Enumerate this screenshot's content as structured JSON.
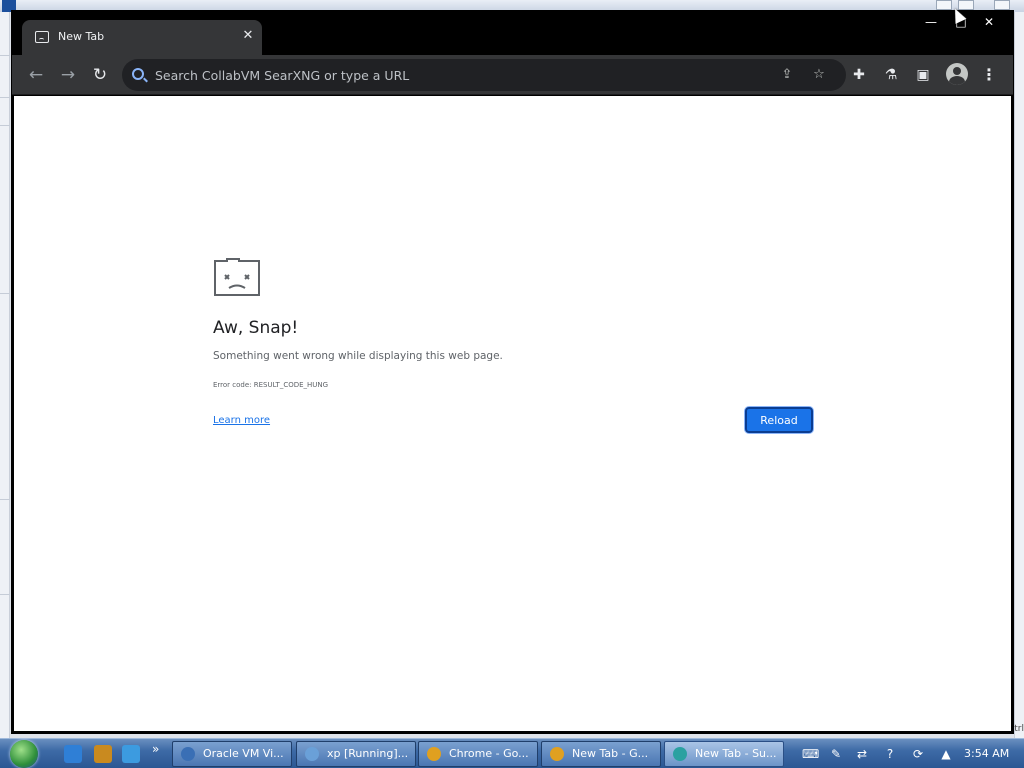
{
  "browser": {
    "tab": {
      "title": "New Tab",
      "close_glyph": "✕",
      "favicon": "sad-tab-icon"
    },
    "window_controls": {
      "minimize": "—",
      "maximize": "□",
      "close": "✕"
    },
    "toolbar": {
      "back_glyph": "←",
      "forward_glyph": "→",
      "reload_glyph": "↻",
      "omnibox_placeholder": "Search CollabVM SearXNG or type a URL",
      "share_glyph": "⇪",
      "bookmark_glyph": "☆",
      "extensions_glyph": "✚",
      "labs_glyph": "⚗",
      "sidepanel_glyph": "▣",
      "menu_glyph": "⋮"
    }
  },
  "error_page": {
    "title": "Aw, Snap!",
    "message": "Something went wrong while displaying this web page.",
    "code": "Error code: RESULT_CODE_HUNG",
    "learn_more": "Learn more",
    "reload_label": "Reload",
    "accent_color": "#1a73e8"
  },
  "host": {
    "ctrl_text": "ctrl"
  },
  "taskbar": {
    "quick_launch_more": "»",
    "buttons": [
      {
        "label": "Oracle VM Vi...",
        "icon": "virtualbox-icon",
        "color": "#3a6fb5"
      },
      {
        "label": "xp [Running]...",
        "icon": "vm-running-icon",
        "color": "#6aa0d8"
      },
      {
        "label": "Chrome - Go...",
        "icon": "chrome-icon",
        "color": "#e0a020"
      },
      {
        "label": "New Tab - G...",
        "icon": "chrome-icon",
        "color": "#e0a020"
      },
      {
        "label": "New Tab - Su...",
        "icon": "app-icon",
        "color": "#2ba1a1"
      }
    ],
    "tray": {
      "keyboard_glyph": "⌨",
      "pen_glyph": "✎",
      "network_glyph": "⇄",
      "help_glyph": "?",
      "sync_glyph": "⟳",
      "arrow_glyph": "▲",
      "clock": "3:54 AM"
    }
  }
}
